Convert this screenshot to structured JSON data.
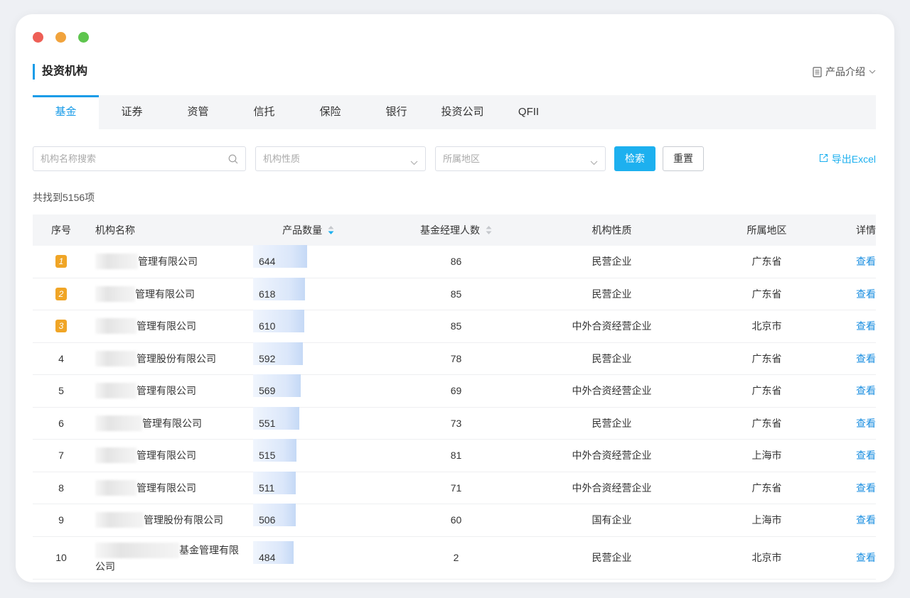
{
  "window": {
    "controls": [
      "close",
      "minimize",
      "maximize"
    ]
  },
  "header": {
    "title": "投资机构",
    "intro_label": "产品介绍"
  },
  "tabs": [
    {
      "label": "基金",
      "active": true
    },
    {
      "label": "证券"
    },
    {
      "label": "资管"
    },
    {
      "label": "信托"
    },
    {
      "label": "保险"
    },
    {
      "label": "银行"
    },
    {
      "label": "投资公司"
    },
    {
      "label": "QFII"
    }
  ],
  "filters": {
    "search_placeholder": "机构名称搜索",
    "type_placeholder": "机构性质",
    "region_placeholder": "所属地区",
    "search_button": "检索",
    "reset_button": "重置",
    "export_label": "导出Excel"
  },
  "result_count": "共找到5156项",
  "table": {
    "headers": {
      "idx": "序号",
      "name": "机构名称",
      "products": "产品数量",
      "managers": "基金经理人数",
      "type": "机构性质",
      "region": "所属地区",
      "detail": "详情"
    },
    "rows": [
      {
        "idx": "1",
        "name": "管理有限公司",
        "products": "644",
        "managers": "86",
        "type": "民营企业",
        "region": "广东省",
        "detail": "查看",
        "bar": 1.0
      },
      {
        "idx": "2",
        "name": "管理有限公司",
        "products": "618",
        "managers": "85",
        "type": "民营企业",
        "region": "广东省",
        "detail": "查看",
        "bar": 0.96
      },
      {
        "idx": "3",
        "name": "管理有限公司",
        "products": "610",
        "managers": "85",
        "type": "中外合资经营企业",
        "region": "北京市",
        "detail": "查看",
        "bar": 0.95
      },
      {
        "idx": "4",
        "name": "管理股份有限公司",
        "products": "592",
        "managers": "78",
        "type": "民营企业",
        "region": "广东省",
        "detail": "查看",
        "bar": 0.92
      },
      {
        "idx": "5",
        "name": "管理有限公司",
        "products": "569",
        "managers": "69",
        "type": "中外合资经营企业",
        "region": "广东省",
        "detail": "查看",
        "bar": 0.88
      },
      {
        "idx": "6",
        "name": "管理有限公司",
        "products": "551",
        "managers": "73",
        "type": "民营企业",
        "region": "广东省",
        "detail": "查看",
        "bar": 0.86
      },
      {
        "idx": "7",
        "name": "管理有限公司",
        "products": "515",
        "managers": "81",
        "type": "中外合资经营企业",
        "region": "上海市",
        "detail": "查看",
        "bar": 0.8
      },
      {
        "idx": "8",
        "name": "管理有限公司",
        "products": "511",
        "managers": "71",
        "type": "中外合资经营企业",
        "region": "广东省",
        "detail": "查看",
        "bar": 0.79
      },
      {
        "idx": "9",
        "name": "管理股份有限公司",
        "products": "506",
        "managers": "60",
        "type": "国有企业",
        "region": "上海市",
        "detail": "查看",
        "bar": 0.79
      },
      {
        "idx": "10",
        "name": "基金管理有限公司",
        "products": "484",
        "managers": "2",
        "type": "民营企业",
        "region": "北京市",
        "detail": "查看",
        "bar": 0.75
      }
    ]
  },
  "colors": {
    "accent": "#1a9ce8",
    "button": "#1db0ef",
    "rank_badge": "#f0a526"
  }
}
